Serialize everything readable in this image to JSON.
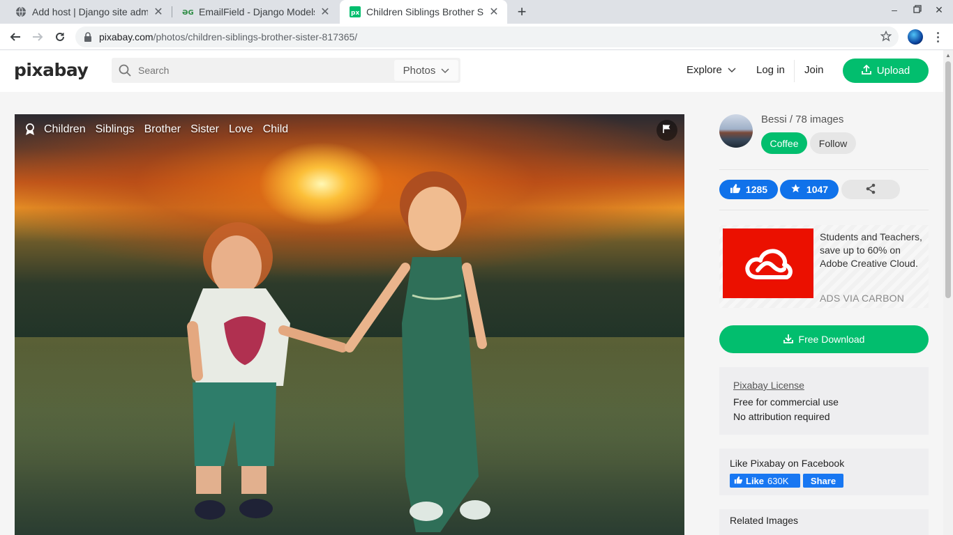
{
  "browser": {
    "tabs": [
      {
        "title": "Add host | Django site admin",
        "favicon": "globe-icon"
      },
      {
        "title": "EmailField - Django Models",
        "favicon": "gfg-icon"
      },
      {
        "title": "Children Siblings Brother Sister Love",
        "favicon": "pixabay-icon"
      }
    ],
    "url_host": "pixabay.com",
    "url_path": "/photos/children-siblings-brother-sister-817365/"
  },
  "header": {
    "logo": "pixabay",
    "search_placeholder": "Search",
    "search_type": "Photos",
    "explore": "Explore",
    "login": "Log in",
    "join": "Join",
    "upload": "Upload"
  },
  "photo": {
    "tags": [
      "Children",
      "Siblings",
      "Brother",
      "Sister",
      "Love",
      "Child"
    ]
  },
  "sidebar": {
    "user": "Bessi / 78 images",
    "coffee": "Coffee",
    "follow": "Follow",
    "likes": "1285",
    "favorites": "1047",
    "ad_text": "Students and Teachers, save up to 60% on Adobe Creative Cloud.",
    "ad_via": "ADS VIA CARBON",
    "download": "Free Download",
    "license_link": "Pixabay License",
    "license_line1": "Free for commercial use",
    "license_line2": "No attribution required",
    "facebook_title": "Like Pixabay on Facebook",
    "fb_like": "Like",
    "fb_count": "630K",
    "fb_share": "Share",
    "related": "Related Images"
  },
  "colors": {
    "brand_green": "#02be6e",
    "like_blue": "#1072ea",
    "adobe_red": "#eb1000",
    "facebook_blue": "#1877f2"
  }
}
